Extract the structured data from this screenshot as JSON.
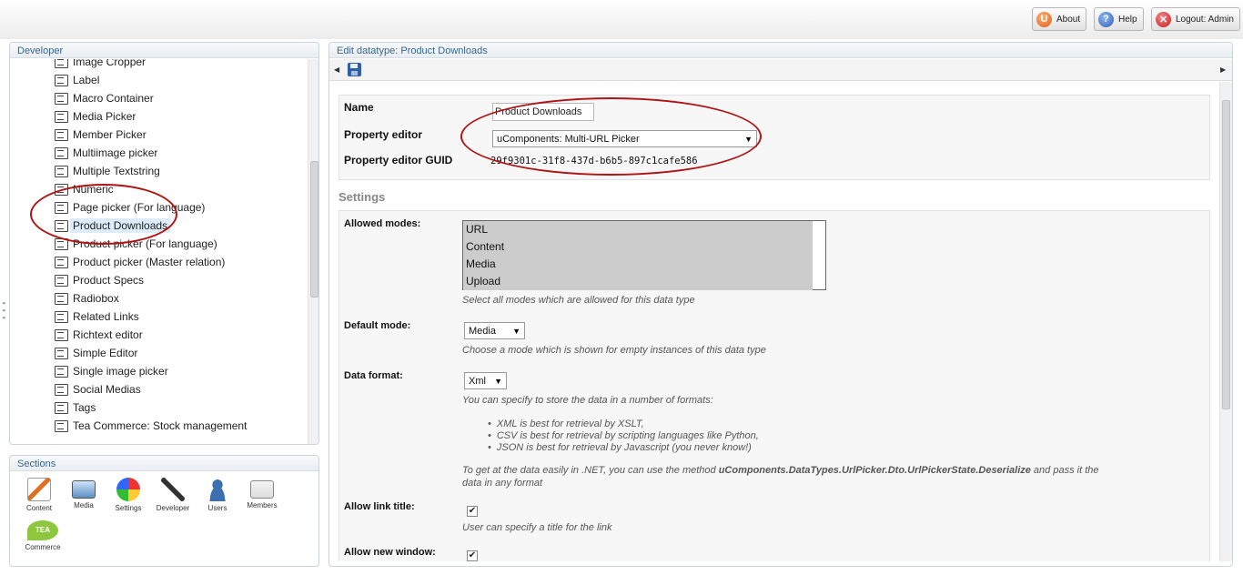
{
  "topbar": {
    "about_label": "About",
    "help_label": "Help",
    "logout_label": "Logout: Admin"
  },
  "developer_panel": {
    "title": "Developer",
    "items": [
      {
        "label": "Image Cropper"
      },
      {
        "label": "Label"
      },
      {
        "label": "Macro Container"
      },
      {
        "label": "Media Picker"
      },
      {
        "label": "Member Picker"
      },
      {
        "label": "Multiimage picker"
      },
      {
        "label": "Multiple Textstring"
      },
      {
        "label": "Numeric"
      },
      {
        "label": "Page picker (For language)"
      },
      {
        "label": "Product Downloads",
        "selected": true
      },
      {
        "label": "Product picker (For language)"
      },
      {
        "label": "Product picker (Master relation)"
      },
      {
        "label": "Product Specs"
      },
      {
        "label": "Radiobox"
      },
      {
        "label": "Related Links"
      },
      {
        "label": "Richtext editor"
      },
      {
        "label": "Simple Editor"
      },
      {
        "label": "Single image picker"
      },
      {
        "label": "Social Medias"
      },
      {
        "label": "Tags"
      },
      {
        "label": "Tea Commerce: Stock management"
      }
    ]
  },
  "sections_panel": {
    "title": "Sections",
    "items": [
      {
        "label": "Content",
        "icon": "pencil-document-icon"
      },
      {
        "label": "Media",
        "icon": "monitor-image-icon"
      },
      {
        "label": "Settings",
        "icon": "color-wheel-icon"
      },
      {
        "label": "Developer",
        "icon": "magic-wand-icon"
      },
      {
        "label": "Users",
        "icon": "user-silhouette-icon"
      },
      {
        "label": "Members",
        "icon": "member-card-icon"
      },
      {
        "label": "Commerce",
        "icon": "tea-leaf-icon",
        "badge": "TEA"
      }
    ]
  },
  "editor": {
    "title": "Edit datatype: Product Downloads",
    "name_label": "Name",
    "name_value": "Product Downloads",
    "property_editor_label": "Property editor",
    "property_editor_value": "uComponents: Multi-URL Picker",
    "guid_label": "Property editor GUID",
    "guid_value": "29f9301c-31f8-437d-b6b5-897c1cafe586",
    "settings_title": "Settings",
    "allowed_modes_label": "Allowed modes:",
    "allowed_modes_options": [
      "URL",
      "Content",
      "Media",
      "Upload"
    ],
    "allowed_modes_hint": "Select all modes which are allowed for this data type",
    "default_mode_label": "Default mode:",
    "default_mode_value": "Media",
    "default_mode_hint": "Choose a mode which is shown for empty instances of this data type",
    "data_format_label": "Data format:",
    "data_format_value": "Xml",
    "data_format_hint": "You can specify to store the data in a number of formats:",
    "data_format_bullets": [
      "XML is best for retrieval by XSLT,",
      "CSV is best for retrieval by scripting languages like Python,",
      "JSON is best for retrieval by Javascript (you never know!)"
    ],
    "net_hint_prefix": "To get at the data easily in .NET, you can use the method ",
    "net_hint_method": "uComponents.DataTypes.UrlPicker.Dto.UrlPickerState.Deserialize",
    "net_hint_suffix": " and pass it the",
    "net_hint_line2": "data in any format",
    "allow_link_title_label": "Allow link title:",
    "allow_link_title_checked": true,
    "allow_link_title_hint": "User can specify a title for the link",
    "allow_new_window_label": "Allow new window:",
    "allow_new_window_checked": true
  },
  "colors": {
    "annotation": "#b01414",
    "panel_header_text": "#39658a",
    "selection": "#dcecf8"
  }
}
